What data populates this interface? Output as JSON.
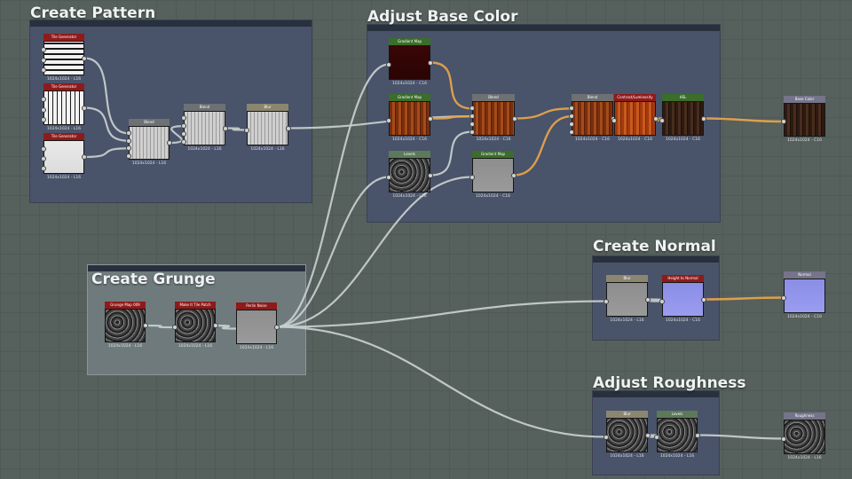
{
  "frames": [
    {
      "id": "create-pattern",
      "title": "Create Pattern"
    },
    {
      "id": "adjust-base-color",
      "title": "Adjust Base Color"
    },
    {
      "id": "create-grunge",
      "title": "Create Grunge"
    },
    {
      "id": "create-normal",
      "title": "Create Normal"
    },
    {
      "id": "adjust-roughness",
      "title": "Adjust Roughness"
    }
  ],
  "nodes": [
    {
      "id": "tile1",
      "name": "tile-generator-node-1",
      "label": "Tile Generator",
      "caption": "1024x1024 - L16",
      "header": "#8f1a1a",
      "thumb": "stripes-h"
    },
    {
      "id": "tile2",
      "name": "tile-generator-node-2",
      "label": "Tile Generator",
      "caption": "1024x1024 - L16",
      "header": "#8f1a1a",
      "thumb": "stripes-v"
    },
    {
      "id": "tile3",
      "name": "tile-generator-node-3",
      "label": "Tile Generator",
      "caption": "1024x1024 - L16",
      "header": "#8f1a1a",
      "thumb": "plain-light"
    },
    {
      "id": "blend1",
      "name": "blend-node-1",
      "label": "Blend",
      "caption": "1024x1024 - L16",
      "header": "#6d7173",
      "thumb": "grid"
    },
    {
      "id": "blend2",
      "name": "blend-node-2",
      "label": "Blend",
      "caption": "1024x1024 - L16",
      "header": "#6d7173",
      "thumb": "grid"
    },
    {
      "id": "blur",
      "name": "blur-node",
      "label": "Blur",
      "caption": "1024x1024 - L16",
      "header": "#8a8670",
      "thumb": "grid"
    },
    {
      "id": "gmap1",
      "name": "gradient-map-node-1",
      "label": "Gradient Map",
      "caption": "1024x1024 - C16",
      "header": "#3a6e2a",
      "thumb": "dark-red"
    },
    {
      "id": "gmap2",
      "name": "gradient-map-node-2",
      "label": "Gradient Map",
      "caption": "1024x1024 - C16",
      "header": "#3a6e2a",
      "thumb": "wood"
    },
    {
      "id": "levels1",
      "name": "levels-node-1",
      "label": "Levels",
      "caption": "1024x1024 - L16",
      "header": "#5c7a5a",
      "thumb": "noise-dark"
    },
    {
      "id": "gmap3",
      "name": "gradient-map-node-3",
      "label": "Gradient Map",
      "caption": "1024x1024 - C16",
      "header": "#3a6e2a",
      "thumb": "plain-gray"
    },
    {
      "id": "blend3",
      "name": "blend-node-3",
      "label": "Blend",
      "caption": "1024x1024 - C16",
      "header": "#6d7173",
      "thumb": "wood"
    },
    {
      "id": "blend4",
      "name": "blend-node-4",
      "label": "Blend",
      "caption": "1024x1024 - C16",
      "header": "#6d7173",
      "thumb": "wood"
    },
    {
      "id": "contrast",
      "name": "contrast-luminosity-node",
      "label": "Contrast/Luminosity",
      "caption": "1024x1024 - C16",
      "header": "#8f1a1a",
      "thumb": "wood-bright"
    },
    {
      "id": "hsl",
      "name": "hsl-node",
      "label": "HSL",
      "caption": "1024x1024 - C16",
      "header": "#3a6e2a",
      "thumb": "wood-dark"
    },
    {
      "id": "out-base",
      "name": "base-color-output-node",
      "label": "Base Color",
      "caption": "1024x1024 - C16",
      "header": "#74748a",
      "thumb": "wood-dark"
    },
    {
      "id": "grunge",
      "name": "grunge-map-node",
      "label": "Grunge Map 009",
      "caption": "1024x1024 - L16",
      "header": "#8f1a1a",
      "thumb": "noise-dark"
    },
    {
      "id": "warp",
      "name": "warp-tile-node",
      "label": "Make It Tile Patch",
      "caption": "1024x1024 - L16",
      "header": "#8f1a1a",
      "thumb": "noise-dark"
    },
    {
      "id": "perlin",
      "name": "perlin-noise-node",
      "label": "Perlin Noise",
      "caption": "1024x1024 - L16",
      "header": "#8f1a1a",
      "thumb": "plain-gray"
    },
    {
      "id": "blur2",
      "name": "blur-node-2",
      "label": "Blur",
      "caption": "1024x1024 - L16",
      "header": "#8a8670",
      "thumb": "plain-gray"
    },
    {
      "id": "h2n",
      "name": "height-to-normal-node",
      "label": "Height to Normal",
      "caption": "1024x1024 - C16",
      "header": "#8f1a1a",
      "thumb": "normal"
    },
    {
      "id": "out-normal",
      "name": "normal-output-node",
      "label": "Normal",
      "caption": "1024x1024 - C16",
      "header": "#74748a",
      "thumb": "normal"
    },
    {
      "id": "blur3",
      "name": "blur-node-3",
      "label": "Blur",
      "caption": "1024x1024 - L16",
      "header": "#8a8670",
      "thumb": "noise-dark"
    },
    {
      "id": "levels2",
      "name": "levels-node-2",
      "label": "Levels",
      "caption": "1024x1024 - L16",
      "header": "#5c7a5a",
      "thumb": "noise-dark"
    },
    {
      "id": "out-rough",
      "name": "roughness-output-node",
      "label": "Roughness",
      "caption": "1024x1024 - L16",
      "header": "#74748a",
      "thumb": "noise-dark"
    }
  ],
  "colors": {
    "background": "#56605d",
    "frame_fill": "#49536a",
    "frame_header": "#27303d",
    "gray_wire": "#c9cfcf",
    "color_wire": "#e8a54a"
  }
}
